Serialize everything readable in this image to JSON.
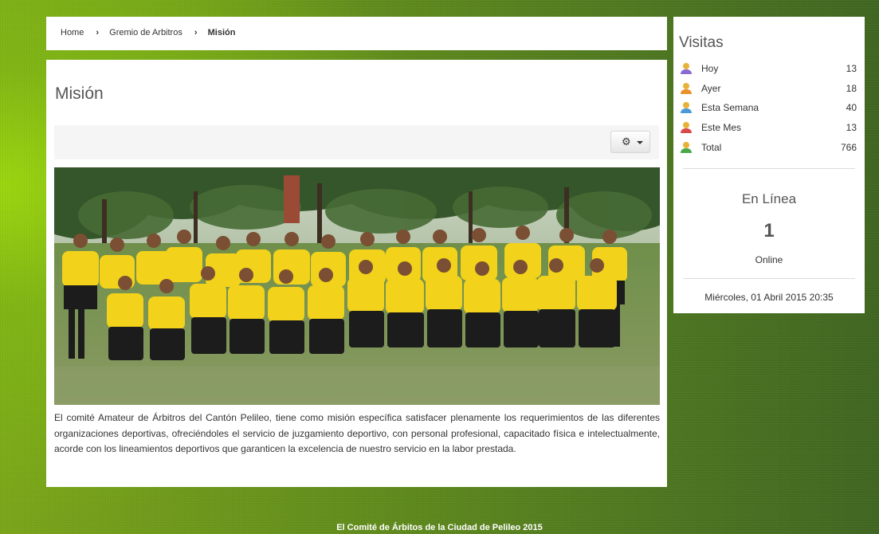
{
  "breadcrumb": {
    "items": [
      "Home",
      "Gremio de Arbitros"
    ],
    "current": "Misión",
    "separator": "›"
  },
  "article": {
    "title": "Misión",
    "toolbar": {
      "icon": "gear-icon"
    },
    "image": {
      "description_icon": "team-photo"
    },
    "text": "El comité Amateur de Árbitros del Cantón Pelileo, tiene como misión específica satisfacer plenamente los requerimientos de las diferentes organizaciones deportivas, ofreciéndoles el servicio de juzgamiento deportivo, con personal profesional, capacitado física e intelectualmente, acorde con los lineamientos deportivos que garanticen la excelencia de nuestro servicio en la labor prestada."
  },
  "sidebar": {
    "visits_title": "Visitas",
    "stats": [
      {
        "label": "Hoy",
        "value": "13",
        "icon": "user-purple-icon",
        "color": "#8a6ad0"
      },
      {
        "label": "Ayer",
        "value": "18",
        "icon": "user-orange-icon",
        "color": "#e8902a"
      },
      {
        "label": "Esta Semana",
        "value": "40",
        "icon": "user-blue-icon",
        "color": "#4a9ad8"
      },
      {
        "label": "Este Mes",
        "value": "13",
        "icon": "user-red-icon",
        "color": "#d84a4a"
      },
      {
        "label": "Total",
        "value": "766",
        "icon": "user-green-icon",
        "color": "#4aa84a"
      }
    ],
    "online_title": "En Línea",
    "online_count": "1",
    "online_label": "Online",
    "datetime": "Miércoles, 01 Abril 2015 20:35"
  },
  "footer": {
    "text": "El Comité de Árbitos de la Ciudad de Pelileo 2015"
  },
  "colors": {
    "background": "#6f9a1c",
    "panel": "#ffffff",
    "jersey": "#f2d21a"
  }
}
